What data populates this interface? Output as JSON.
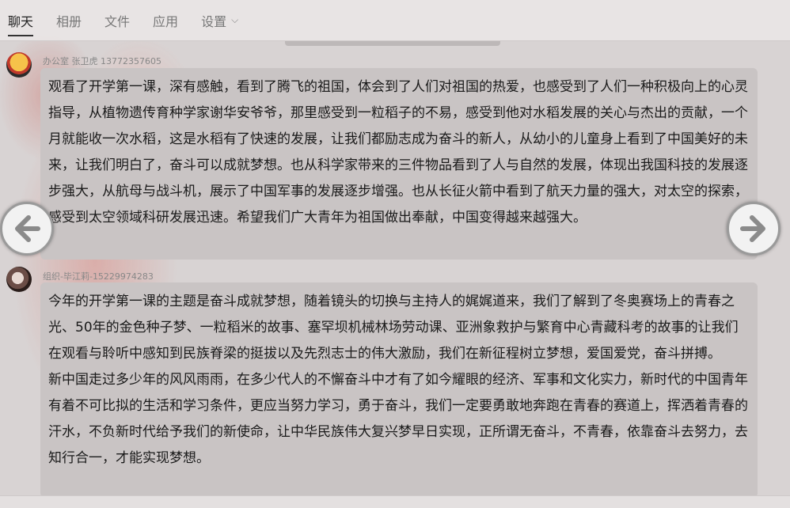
{
  "tabs": [
    {
      "label": "聊天",
      "active": true
    },
    {
      "label": "相册",
      "active": false
    },
    {
      "label": "文件",
      "active": false
    },
    {
      "label": "应用",
      "active": false
    },
    {
      "label": "设置",
      "active": false,
      "dropdown": true
    }
  ],
  "messages": [
    {
      "sender": "办公室 张卫虎 13772357605",
      "paragraphs": [
        "观看了开学第一课，深有感触，看到了腾飞的祖国，体会到了人们对祖国的热爱，也感受到了人们一种积极向上的心灵指导，从植物遗传育种学家谢华安爷爷，那里感受到一粒稻子的不易，感受到他对水稻发展的关心与杰出的贡献，一个月就能收一次水稻，这是水稻有了快速的发展，让我们都励志成为奋斗的新人，从幼小的儿童身上看到了中国美好的未来，让我们明白了，奋斗可以成就梦想。也从科学家带来的三件物品看到了人与自然的发展，体现出我国科技的发展逐步强大，从航母与战斗机，展示了中国军事的发展逐步增强。也从长征火箭中看到了航天力量的强大，对太空的探索，感受到太空领域科研发展迅速。希望我们广大青年为祖国做出奉献，中国变得越来越强大。"
      ]
    },
    {
      "sender": "组织-毕江莉-15229974283",
      "paragraphs": [
        "今年的开学第一课的主题是奋斗成就梦想，随着镜头的切换与主持人的娓娓道来，我们了解到了冬奥赛场上的青春之光、50年的金色种子梦、一粒稻米的故事、塞罕坝机械林场劳动课、亚洲象救护与繁育中心青藏科考的故事的让我们在观看与聆听中感知到民族脊梁的挺拔以及先烈志士的伟大激励，我们在新征程树立梦想，爱国爱党，奋斗拼搏。",
        "新中国走过多少年的风风雨雨，在多少代人的不懈奋斗中才有了如今耀眼的经济、军事和文化实力，新时代的中国青年有着不可比拟的生活和学习条件，更应当努力学习，勇于奋斗，我们一定要勇敢地奔跑在青春的赛道上，挥洒着青春的汗水，不负新时代给予我们的新使命，让中华民族伟大复兴梦早日实现，正所谓无奋斗，不青春，依靠奋斗去努力，去知行合一，才能实现梦想。"
      ]
    }
  ],
  "icons": {
    "prev": "arrow-left-icon",
    "next": "arrow-right-icon",
    "dropdown": "chevron-down-icon"
  }
}
